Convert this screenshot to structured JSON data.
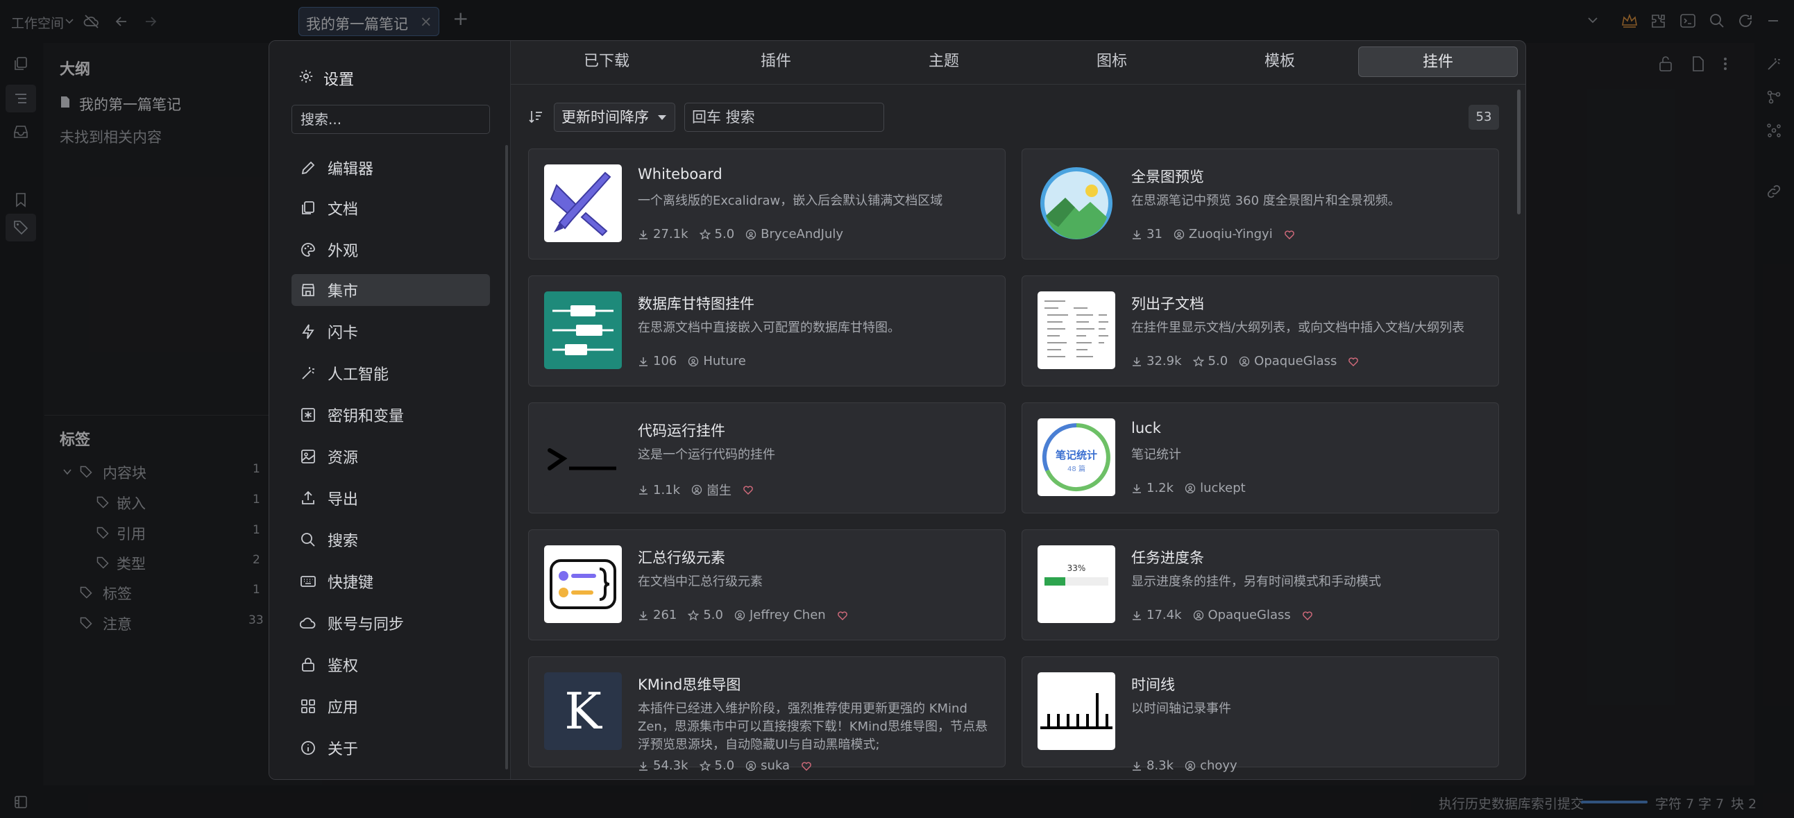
{
  "topbar": {
    "workspace": "工作空间",
    "tab_title": "我的第一篇笔记",
    "tab_close": "×",
    "new_tab": "+"
  },
  "outline": {
    "title": "大纲",
    "doc": "我的第一篇笔记",
    "empty": "未找到相关内容",
    "tags_title": "标签",
    "tags": [
      {
        "label": "内容块",
        "count": "1"
      },
      {
        "label": "嵌入",
        "count": "1"
      },
      {
        "label": "引用",
        "count": "1"
      },
      {
        "label": "类型",
        "count": "2"
      },
      {
        "label": "标签",
        "count": "1"
      },
      {
        "label": "注意",
        "count": "33"
      }
    ]
  },
  "settings": {
    "title": "设置",
    "search_placeholder": "搜索...",
    "nav": [
      {
        "label": "编辑器",
        "icon": "pencil-icon"
      },
      {
        "label": "文档",
        "icon": "document-icon"
      },
      {
        "label": "外观",
        "icon": "palette-icon"
      },
      {
        "label": "集市",
        "icon": "store-icon"
      },
      {
        "label": "闪卡",
        "icon": "flash-icon"
      },
      {
        "label": "人工智能",
        "icon": "magic-wand-icon"
      },
      {
        "label": "密钥和变量",
        "icon": "key-icon"
      },
      {
        "label": "资源",
        "icon": "image-icon"
      },
      {
        "label": "导出",
        "icon": "export-icon"
      },
      {
        "label": "搜索",
        "icon": "search-icon"
      },
      {
        "label": "快捷键",
        "icon": "keyboard-icon"
      },
      {
        "label": "账号与同步",
        "icon": "cloud-icon"
      },
      {
        "label": "鉴权",
        "icon": "lock-icon"
      },
      {
        "label": "应用",
        "icon": "apps-icon"
      },
      {
        "label": "关于",
        "icon": "info-icon"
      }
    ],
    "active_nav": "集市"
  },
  "bazaar": {
    "tabs": [
      "已下载",
      "插件",
      "主题",
      "图标",
      "模板",
      "挂件"
    ],
    "active_tab": "挂件",
    "sort": "更新时间降序",
    "filter_placeholder": "回车 搜索",
    "count": "53",
    "cards": [
      {
        "title": "Whiteboard",
        "desc": "一个离线版的Excalidraw，嵌入后会默认铺满文档区域",
        "downloads": "27.1k",
        "rating": "5.0",
        "author": "BryceAndJuly",
        "thumb": "whiteboard"
      },
      {
        "title": "全景图预览",
        "desc": "在思源笔记中预览 360 度全景图片和全景视频。",
        "downloads": "31",
        "rating": "",
        "author": "Zuoqiu-Yingyi",
        "thumb": "panorama"
      },
      {
        "title": "数据库甘特图挂件",
        "desc": "在思源文档中直接嵌入可配置的数据库甘特图。",
        "downloads": "106",
        "rating": "",
        "author": "Huture",
        "thumb": "gantt"
      },
      {
        "title": "列出子文档",
        "desc": "在挂件里显示文档/大纲列表，或向文档中插入文档/大纲列表",
        "downloads": "32.9k",
        "rating": "5.0",
        "author": "OpaqueGlass",
        "thumb": "list"
      },
      {
        "title": "代码运行挂件",
        "desc": "这是一个运行代码的挂件",
        "downloads": "1.1k",
        "rating": "",
        "author": "崮生",
        "thumb": "terminal"
      },
      {
        "title": "luck",
        "desc": "笔记统计",
        "downloads": "1.2k",
        "rating": "",
        "author": "luckept",
        "thumb": "stats",
        "thumb_text": "笔记统计",
        "thumb_sub": "48 篇"
      },
      {
        "title": "汇总行级元素",
        "desc": "在文档中汇总行级元素",
        "downloads": "261",
        "rating": "5.0",
        "author": "Jeffrey Chen",
        "thumb": "summary"
      },
      {
        "title": "任务进度条",
        "desc": "显示进度条的挂件，另有时间模式和手动模式",
        "downloads": "17.4k",
        "rating": "",
        "author": "OpaqueGlass",
        "thumb": "progress",
        "thumb_text": "33%"
      },
      {
        "title": "KMind思维导图",
        "desc": "本插件已经进入维护阶段，强烈推荐使用更新更强的 KMind Zen，思源集市中可以直接搜索下载！KMind思维导图，节点悬浮预览思源块，自动隐藏UI与自动黑暗模式;",
        "downloads": "54.3k",
        "rating": "5.0",
        "author": "suka",
        "thumb": "kmind",
        "thumb_text": "K"
      },
      {
        "title": "时间线",
        "desc": "以时间轴记录事件",
        "downloads": "8.3k",
        "rating": "",
        "author": "choyy",
        "thumb": "timeline"
      }
    ]
  },
  "statusbar": {
    "message": "执行历史数据库索引提交",
    "chars": "字符 7",
    "words": "字 7",
    "blocks": "块 2"
  }
}
